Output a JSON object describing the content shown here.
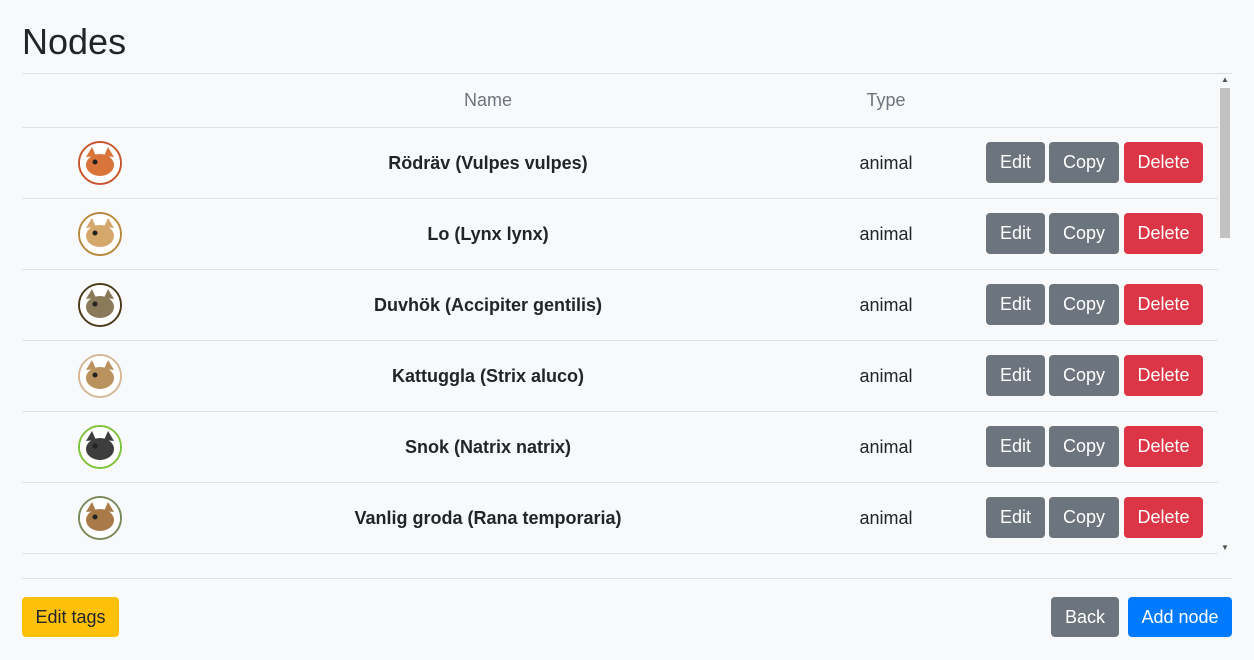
{
  "page": {
    "title": "Nodes"
  },
  "table": {
    "headers": {
      "name": "Name",
      "type": "Type"
    },
    "rows": [
      {
        "name": "Rödräv (Vulpes vulpes)",
        "type": "animal",
        "icon": "fox-icon",
        "ring": "#c9532a",
        "fill": "#d9743a"
      },
      {
        "name": "Lo (Lynx lynx)",
        "type": "animal",
        "icon": "lynx-icon",
        "ring": "#b8893d",
        "fill": "#d6a76a"
      },
      {
        "name": "Duvhök (Accipiter gentilis)",
        "type": "animal",
        "icon": "goshawk-icon",
        "ring": "#4a3a1a",
        "fill": "#8a7a5a"
      },
      {
        "name": "Kattuggla (Strix aluco)",
        "type": "animal",
        "icon": "owl-icon",
        "ring": "#d4b896",
        "fill": "#b9925e"
      },
      {
        "name": "Snok (Natrix natrix)",
        "type": "animal",
        "icon": "snake-icon",
        "ring": "#7fc33a",
        "fill": "#3d3d3d"
      },
      {
        "name": "Vanlig groda (Rana temporaria)",
        "type": "animal",
        "icon": "frog-icon",
        "ring": "#7a8a5a",
        "fill": "#a87a48"
      }
    ],
    "actions": {
      "edit": "Edit",
      "copy": "Copy",
      "delete": "Delete"
    }
  },
  "footer": {
    "edit_tags": "Edit tags",
    "back": "Back",
    "add_node": "Add node"
  },
  "colors": {
    "secondary": "#6c757d",
    "danger": "#dc3545",
    "warning": "#ffc107",
    "primary": "#007bff"
  }
}
